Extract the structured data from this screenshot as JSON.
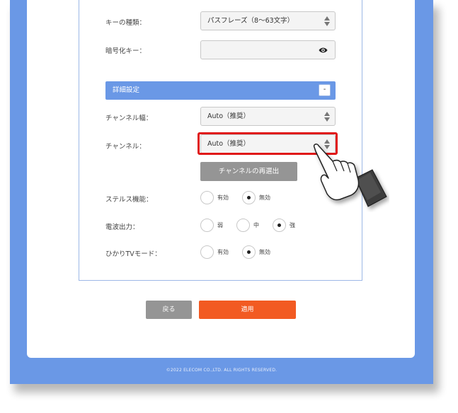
{
  "form": {
    "key_type": {
      "label": "キーの種類：",
      "value": "パスフレーズ（8～63文字）"
    },
    "encryption_key": {
      "label": "暗号化キー：",
      "value": "",
      "icon": "eye-icon"
    },
    "advanced": {
      "title": "詳細設定",
      "toggle": "-"
    },
    "channel_width": {
      "label": "チャンネル幅：",
      "value": "Auto（推奨）"
    },
    "channel": {
      "label": "チャンネル：",
      "value": "Auto（推奨）"
    },
    "reselect_button": "チャンネルの再選出",
    "stealth": {
      "label": "ステルス機能：",
      "options": [
        "有効",
        "無効"
      ],
      "selected": "無効"
    },
    "tx_power": {
      "label": "電波出力：",
      "options": [
        "弱",
        "中",
        "強"
      ],
      "selected": "強"
    },
    "hikari_tv": {
      "label": "ひかりTVモード：",
      "options": [
        "有効",
        "無効"
      ],
      "selected": "無効"
    }
  },
  "actions": {
    "back": "戻る",
    "apply": "適用"
  },
  "footer": "©2022 ELECOM CO.,LTD. ALL RIGHTS RESERVED.",
  "colors": {
    "frame": "#6a98e6",
    "apply": "#f25a22",
    "gray_button": "#959595",
    "highlight": "#e01818"
  },
  "annotation_icon": "pointing-hand-icon"
}
